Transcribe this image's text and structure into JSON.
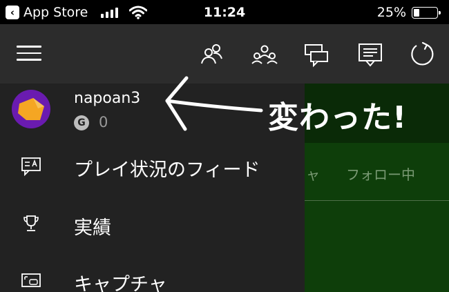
{
  "status_bar": {
    "back_app": "App Store",
    "time": "11:24",
    "battery": "25%",
    "battery_level": 0.25
  },
  "header": {
    "icons": [
      "hamburger-menu-icon",
      "friends-icon",
      "party-icon",
      "messages-icon",
      "activity-feed-icon",
      "refresh-icon"
    ]
  },
  "profile": {
    "username": "napoan3",
    "gamerscore_badge": "G",
    "gamerscore": "0"
  },
  "drawer": {
    "items": [
      {
        "label": "プレイ状況のフィード",
        "icon": "feed-icon"
      },
      {
        "label": "実績",
        "icon": "trophy-icon"
      },
      {
        "label": "キャプチャ",
        "icon": "capture-icon"
      }
    ]
  },
  "content": {
    "tab_partial": "ャ",
    "tab_following": "フォロー中"
  },
  "annotation": {
    "text": "変わった!"
  },
  "colors": {
    "drawer_bg": "#222222",
    "header_bg": "#2c2c2c",
    "content_green": "#0e3e0a",
    "avatar_purple": "#6a1bb0",
    "avatar_orange": "#f5a623"
  }
}
